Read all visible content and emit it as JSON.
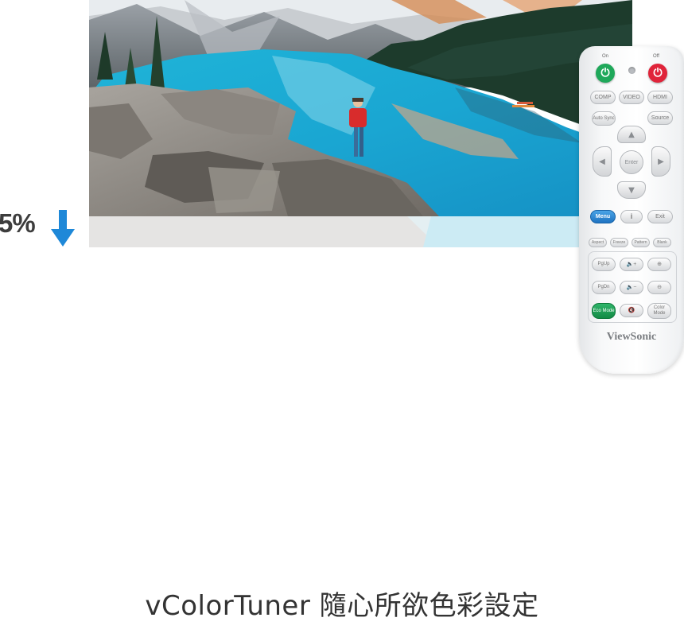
{
  "brightness_change": {
    "value_text": "5%",
    "direction_icon": "arrow-down-icon",
    "arrow_color": "#1e88d8"
  },
  "remote": {
    "power_on_label": "On",
    "power_off_label": "Off",
    "power_on_color": "#1fa85a",
    "power_off_color": "#e0243a",
    "source_buttons": [
      "COMP",
      "VIDEO",
      "HDMI"
    ],
    "auto_sync_label": "Auto Sync",
    "source_label": "Source",
    "enter_label": "Enter",
    "menu_label": "Menu",
    "info_label": "i",
    "exit_label": "Exit",
    "function_buttons": [
      "Aspect",
      "Freeze",
      "Pattern",
      "Blank"
    ],
    "pgup_label": "PgUp",
    "pgdn_label": "PgDn",
    "eco_mode_label": "Eco Mode",
    "color_mode_label": "Color Mode",
    "brand": "ViewSonic"
  },
  "caption": "vColorTuner 隨心所欲色彩設定"
}
